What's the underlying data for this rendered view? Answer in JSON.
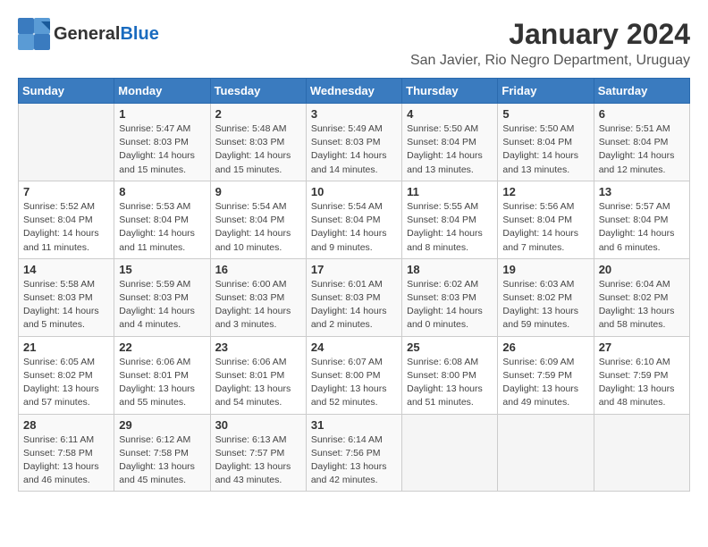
{
  "header": {
    "logo_general": "General",
    "logo_blue": "Blue",
    "month_year": "January 2024",
    "location": "San Javier, Rio Negro Department, Uruguay"
  },
  "calendar": {
    "weekdays": [
      "Sunday",
      "Monday",
      "Tuesday",
      "Wednesday",
      "Thursday",
      "Friday",
      "Saturday"
    ],
    "weeks": [
      [
        {
          "day": "",
          "info": ""
        },
        {
          "day": "1",
          "info": "Sunrise: 5:47 AM\nSunset: 8:03 PM\nDaylight: 14 hours\nand 15 minutes."
        },
        {
          "day": "2",
          "info": "Sunrise: 5:48 AM\nSunset: 8:03 PM\nDaylight: 14 hours\nand 15 minutes."
        },
        {
          "day": "3",
          "info": "Sunrise: 5:49 AM\nSunset: 8:03 PM\nDaylight: 14 hours\nand 14 minutes."
        },
        {
          "day": "4",
          "info": "Sunrise: 5:50 AM\nSunset: 8:04 PM\nDaylight: 14 hours\nand 13 minutes."
        },
        {
          "day": "5",
          "info": "Sunrise: 5:50 AM\nSunset: 8:04 PM\nDaylight: 14 hours\nand 13 minutes."
        },
        {
          "day": "6",
          "info": "Sunrise: 5:51 AM\nSunset: 8:04 PM\nDaylight: 14 hours\nand 12 minutes."
        }
      ],
      [
        {
          "day": "7",
          "info": "Sunrise: 5:52 AM\nSunset: 8:04 PM\nDaylight: 14 hours\nand 11 minutes."
        },
        {
          "day": "8",
          "info": "Sunrise: 5:53 AM\nSunset: 8:04 PM\nDaylight: 14 hours\nand 11 minutes."
        },
        {
          "day": "9",
          "info": "Sunrise: 5:54 AM\nSunset: 8:04 PM\nDaylight: 14 hours\nand 10 minutes."
        },
        {
          "day": "10",
          "info": "Sunrise: 5:54 AM\nSunset: 8:04 PM\nDaylight: 14 hours\nand 9 minutes."
        },
        {
          "day": "11",
          "info": "Sunrise: 5:55 AM\nSunset: 8:04 PM\nDaylight: 14 hours\nand 8 minutes."
        },
        {
          "day": "12",
          "info": "Sunrise: 5:56 AM\nSunset: 8:04 PM\nDaylight: 14 hours\nand 7 minutes."
        },
        {
          "day": "13",
          "info": "Sunrise: 5:57 AM\nSunset: 8:04 PM\nDaylight: 14 hours\nand 6 minutes."
        }
      ],
      [
        {
          "day": "14",
          "info": "Sunrise: 5:58 AM\nSunset: 8:03 PM\nDaylight: 14 hours\nand 5 minutes."
        },
        {
          "day": "15",
          "info": "Sunrise: 5:59 AM\nSunset: 8:03 PM\nDaylight: 14 hours\nand 4 minutes."
        },
        {
          "day": "16",
          "info": "Sunrise: 6:00 AM\nSunset: 8:03 PM\nDaylight: 14 hours\nand 3 minutes."
        },
        {
          "day": "17",
          "info": "Sunrise: 6:01 AM\nSunset: 8:03 PM\nDaylight: 14 hours\nand 2 minutes."
        },
        {
          "day": "18",
          "info": "Sunrise: 6:02 AM\nSunset: 8:03 PM\nDaylight: 14 hours\nand 0 minutes."
        },
        {
          "day": "19",
          "info": "Sunrise: 6:03 AM\nSunset: 8:02 PM\nDaylight: 13 hours\nand 59 minutes."
        },
        {
          "day": "20",
          "info": "Sunrise: 6:04 AM\nSunset: 8:02 PM\nDaylight: 13 hours\nand 58 minutes."
        }
      ],
      [
        {
          "day": "21",
          "info": "Sunrise: 6:05 AM\nSunset: 8:02 PM\nDaylight: 13 hours\nand 57 minutes."
        },
        {
          "day": "22",
          "info": "Sunrise: 6:06 AM\nSunset: 8:01 PM\nDaylight: 13 hours\nand 55 minutes."
        },
        {
          "day": "23",
          "info": "Sunrise: 6:06 AM\nSunset: 8:01 PM\nDaylight: 13 hours\nand 54 minutes."
        },
        {
          "day": "24",
          "info": "Sunrise: 6:07 AM\nSunset: 8:00 PM\nDaylight: 13 hours\nand 52 minutes."
        },
        {
          "day": "25",
          "info": "Sunrise: 6:08 AM\nSunset: 8:00 PM\nDaylight: 13 hours\nand 51 minutes."
        },
        {
          "day": "26",
          "info": "Sunrise: 6:09 AM\nSunset: 7:59 PM\nDaylight: 13 hours\nand 49 minutes."
        },
        {
          "day": "27",
          "info": "Sunrise: 6:10 AM\nSunset: 7:59 PM\nDaylight: 13 hours\nand 48 minutes."
        }
      ],
      [
        {
          "day": "28",
          "info": "Sunrise: 6:11 AM\nSunset: 7:58 PM\nDaylight: 13 hours\nand 46 minutes."
        },
        {
          "day": "29",
          "info": "Sunrise: 6:12 AM\nSunset: 7:58 PM\nDaylight: 13 hours\nand 45 minutes."
        },
        {
          "day": "30",
          "info": "Sunrise: 6:13 AM\nSunset: 7:57 PM\nDaylight: 13 hours\nand 43 minutes."
        },
        {
          "day": "31",
          "info": "Sunrise: 6:14 AM\nSunset: 7:56 PM\nDaylight: 13 hours\nand 42 minutes."
        },
        {
          "day": "",
          "info": ""
        },
        {
          "day": "",
          "info": ""
        },
        {
          "day": "",
          "info": ""
        }
      ]
    ]
  }
}
